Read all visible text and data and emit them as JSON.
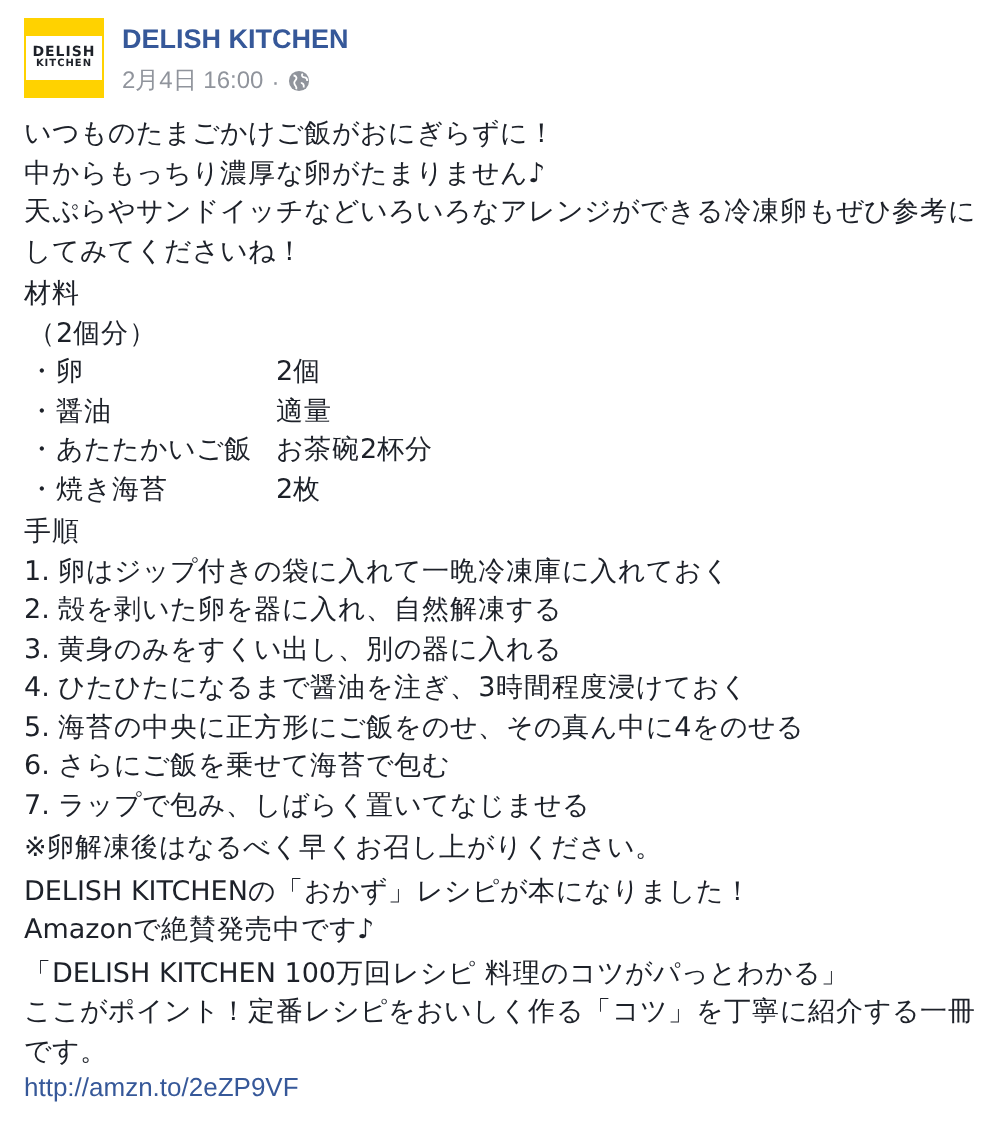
{
  "post": {
    "author": "DELISH KITCHEN",
    "logo_lines": [
      "DELISH",
      "KITCHEN"
    ],
    "time": "2月4日 16:00",
    "separator": "·"
  },
  "intro": [
    "いつものたまごかけご飯がおにぎらずに！",
    "中からもっちり濃厚な卵がたまりません♪",
    "天ぷらやサンドイッチなどいろいろなアレンジができる冷凍卵もぜひ参考に",
    "してみてくださいね！"
  ],
  "ingredients": {
    "heading": "材料",
    "servings": "（2個分）",
    "items": [
      {
        "name": "・卵",
        "amount": "2個"
      },
      {
        "name": "・醤油",
        "amount": "適量"
      },
      {
        "name": "・あたたかいご飯",
        "amount": "お茶碗2杯分"
      },
      {
        "name": "・焼き海苔",
        "amount": "2枚"
      }
    ]
  },
  "steps": {
    "heading": "手順",
    "items": [
      "1. 卵はジップ付きの袋に入れて一晩冷凍庫に入れておく",
      "2. 殻を剥いた卵を器に入れ、自然解凍する",
      "3. 黄身のみをすくい出し、別の器に入れる",
      "4. ひたひたになるまで醤油を注ぎ、3時間程度浸けておく",
      "5. 海苔の中央に正方形にご飯をのせ、その真ん中に4をのせる",
      "6. さらにご飯を乗せて海苔で包む",
      "7. ラップで包み、しばらく置いてなじませる"
    ]
  },
  "note": "※卵解凍後はなるべく早くお召し上がりください。",
  "promo": [
    "DELISH KITCHENの「おかず」レシピが本になりました！",
    "Amazonで絶賛発売中です♪"
  ],
  "book": [
    "「DELISH KITCHEN 100万回レシピ 料理のコツがパっとわかる」",
    "ここがポイント！定番レシピをおいしく作る「コツ」を丁寧に紹介する一冊",
    "です。"
  ],
  "link": "http://amzn.to/2eZP9VF"
}
